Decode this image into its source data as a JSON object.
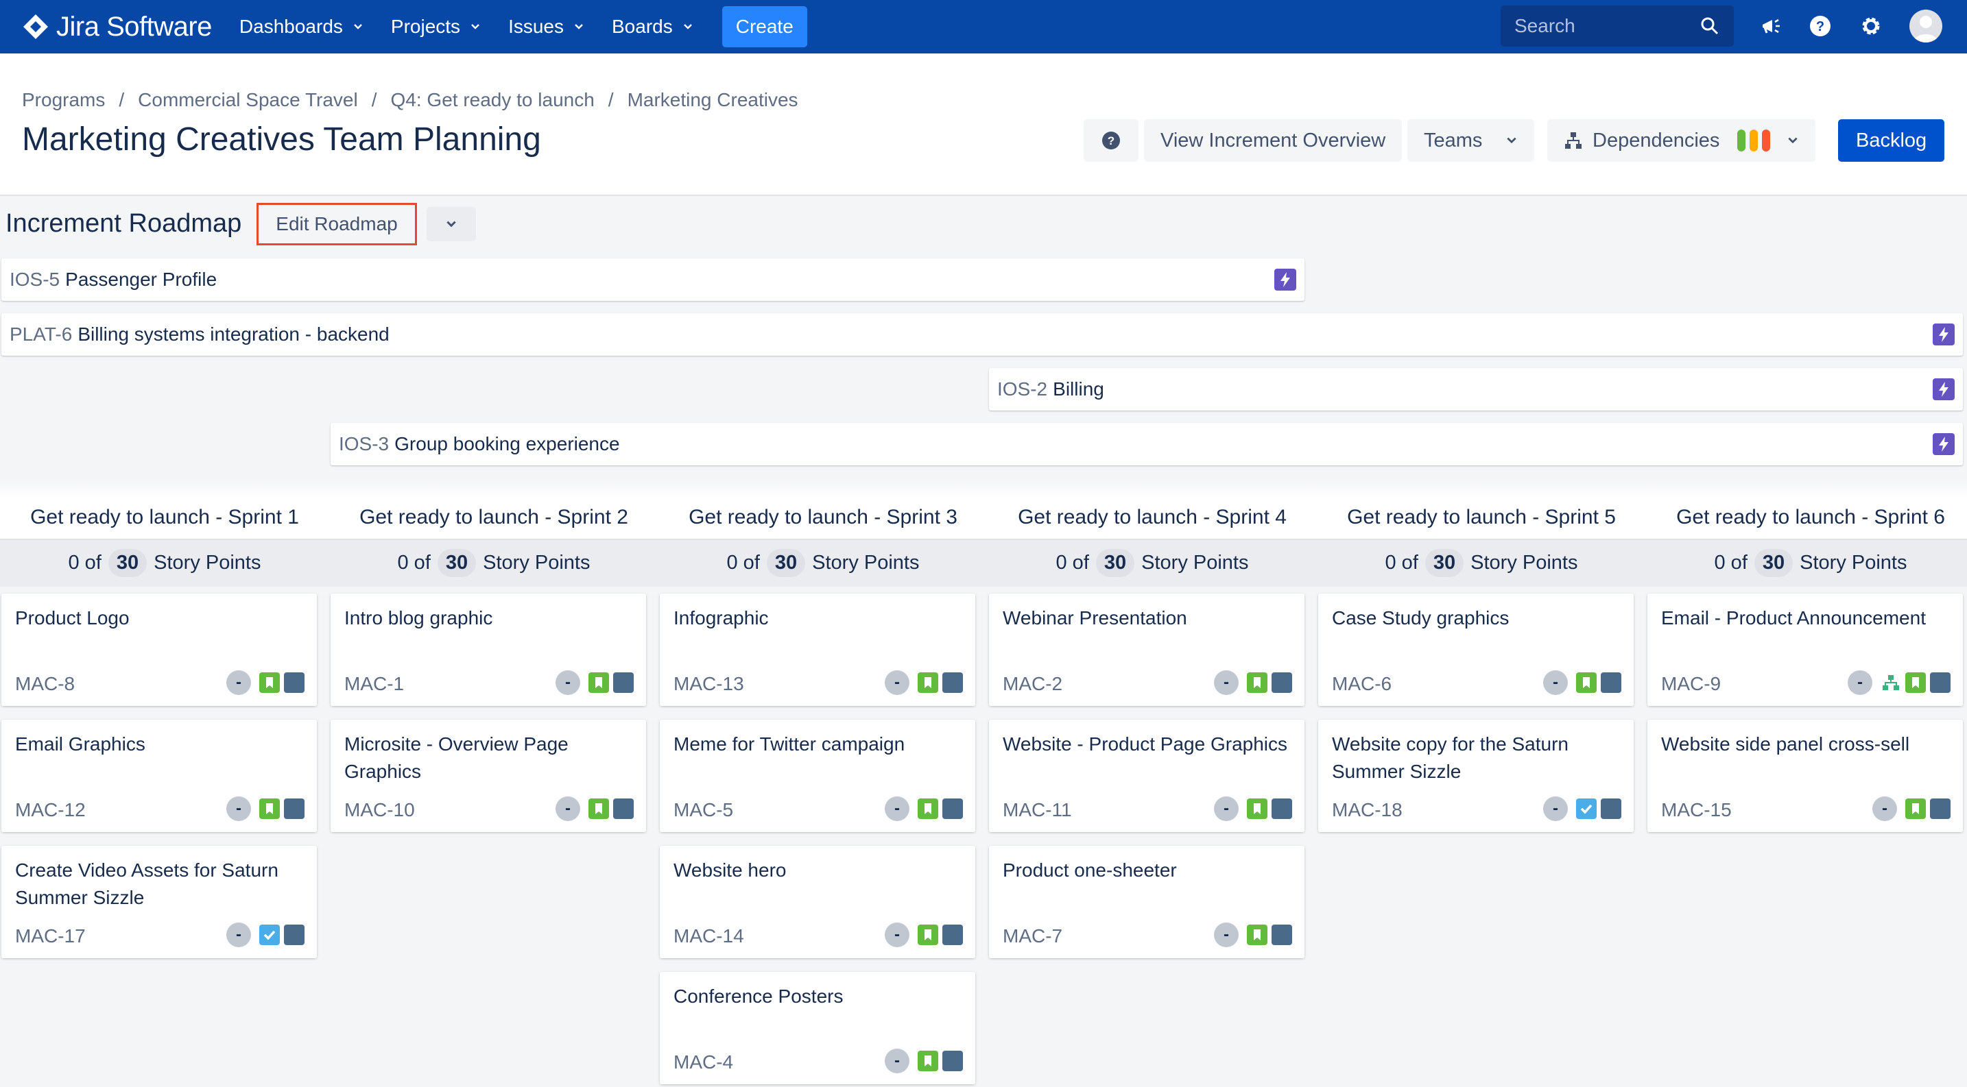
{
  "nav": {
    "logo_text": "Jira Software",
    "items": [
      "Dashboards",
      "Projects",
      "Issues",
      "Boards"
    ],
    "create_label": "Create",
    "search_placeholder": "Search"
  },
  "breadcrumbs": [
    "Programs",
    "Commercial Space Travel",
    "Q4: Get ready to launch",
    "Marketing Creatives"
  ],
  "page_title": "Marketing Creatives Team Planning",
  "header_buttons": {
    "help": "?",
    "view_increment": "View Increment Overview",
    "teams": "Teams",
    "dependencies": "Dependencies",
    "backlog": "Backlog"
  },
  "dependency_colors": [
    "#63ba3c",
    "#ffab00",
    "#ff5630"
  ],
  "roadmap": {
    "title": "Increment Roadmap",
    "edit_label": "Edit Roadmap",
    "epics": [
      {
        "key": "IOS-5",
        "title": "Passenger Profile"
      },
      {
        "key": "PLAT-6",
        "title": "Billing systems integration - backend"
      },
      {
        "key": "IOS-2",
        "title": "Billing"
      },
      {
        "key": "IOS-3",
        "title": "Group booking experience"
      }
    ]
  },
  "sprints": [
    {
      "name": "Get ready to launch - Sprint 1",
      "done": "0 of",
      "total": "30",
      "unit": "Story Points"
    },
    {
      "name": "Get ready to launch - Sprint 2",
      "done": "0 of",
      "total": "30",
      "unit": "Story Points"
    },
    {
      "name": "Get ready to launch - Sprint 3",
      "done": "0 of",
      "total": "30",
      "unit": "Story Points"
    },
    {
      "name": "Get ready to launch - Sprint 4",
      "done": "0 of",
      "total": "30",
      "unit": "Story Points"
    },
    {
      "name": "Get ready to launch - Sprint 5",
      "done": "0 of",
      "total": "30",
      "unit": "Story Points"
    },
    {
      "name": "Get ready to launch - Sprint 6",
      "done": "0 of",
      "total": "30",
      "unit": "Story Points"
    }
  ],
  "cards": [
    {
      "title": "Product Logo",
      "key": "MAC-8",
      "estimate": "-",
      "type": "story"
    },
    {
      "title": "Email Graphics",
      "key": "MAC-12",
      "estimate": "-",
      "type": "story"
    },
    {
      "title": "Create Video Assets for Saturn Summer Sizzle",
      "key": "MAC-17",
      "estimate": "-",
      "type": "task"
    },
    {
      "title": "Intro blog graphic",
      "key": "MAC-1",
      "estimate": "-",
      "type": "story"
    },
    {
      "title": "Microsite - Overview Page Graphics",
      "key": "MAC-10",
      "estimate": "-",
      "type": "story"
    },
    {
      "title": "Infographic",
      "key": "MAC-13",
      "estimate": "-",
      "type": "story"
    },
    {
      "title": "Meme for Twitter campaign",
      "key": "MAC-5",
      "estimate": "-",
      "type": "story"
    },
    {
      "title": "Website hero",
      "key": "MAC-14",
      "estimate": "-",
      "type": "story"
    },
    {
      "title": "Conference Posters",
      "key": "MAC-4",
      "estimate": "-",
      "type": "story"
    },
    {
      "title": "Webinar Presentation",
      "key": "MAC-2",
      "estimate": "-",
      "type": "story"
    },
    {
      "title": "Website - Product Page Graphics",
      "key": "MAC-11",
      "estimate": "-",
      "type": "story"
    },
    {
      "title": "Product one-sheeter",
      "key": "MAC-7",
      "estimate": "-",
      "type": "story"
    },
    {
      "title": "Case Study graphics",
      "key": "MAC-6",
      "estimate": "-",
      "type": "story"
    },
    {
      "title": "Website copy for the Saturn Summer Sizzle",
      "key": "MAC-18",
      "estimate": "-",
      "type": "task"
    },
    {
      "title": "Email - Product Announcement",
      "key": "MAC-9",
      "estimate": "-",
      "type": "story",
      "dependency_icon": "dependency-icon"
    },
    {
      "title": "Website side panel cross-sell",
      "key": "MAC-15",
      "estimate": "-",
      "type": "story"
    }
  ],
  "icons": {
    "epic": "lightning-epic-icon",
    "story": "bookmark-story-icon",
    "task": "checkbox-task-icon",
    "priority": "priority-icon"
  }
}
